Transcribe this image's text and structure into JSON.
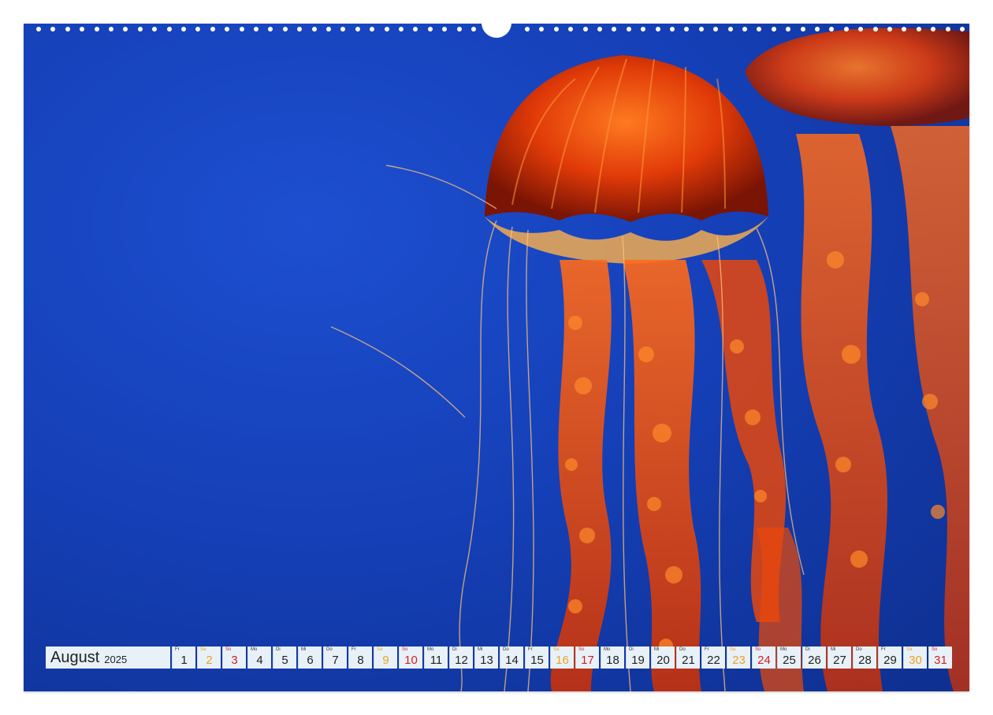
{
  "calendar": {
    "month": "August",
    "year": "2025",
    "days": [
      {
        "weekday": "Fr",
        "day": "1",
        "type": "weekday"
      },
      {
        "weekday": "Sa",
        "day": "2",
        "type": "sat"
      },
      {
        "weekday": "So",
        "day": "3",
        "type": "sun"
      },
      {
        "weekday": "Mo",
        "day": "4",
        "type": "weekday"
      },
      {
        "weekday": "Di",
        "day": "5",
        "type": "weekday"
      },
      {
        "weekday": "Mi",
        "day": "6",
        "type": "weekday"
      },
      {
        "weekday": "Do",
        "day": "7",
        "type": "weekday"
      },
      {
        "weekday": "Fr",
        "day": "8",
        "type": "weekday"
      },
      {
        "weekday": "Sa",
        "day": "9",
        "type": "sat"
      },
      {
        "weekday": "So",
        "day": "10",
        "type": "sun"
      },
      {
        "weekday": "Mo",
        "day": "11",
        "type": "weekday"
      },
      {
        "weekday": "Di",
        "day": "12",
        "type": "weekday"
      },
      {
        "weekday": "Mi",
        "day": "13",
        "type": "weekday"
      },
      {
        "weekday": "Do",
        "day": "14",
        "type": "weekday"
      },
      {
        "weekday": "Fr",
        "day": "15",
        "type": "weekday"
      },
      {
        "weekday": "Sa",
        "day": "16",
        "type": "sat"
      },
      {
        "weekday": "So",
        "day": "17",
        "type": "sun"
      },
      {
        "weekday": "Mo",
        "day": "18",
        "type": "weekday"
      },
      {
        "weekday": "Di",
        "day": "19",
        "type": "weekday"
      },
      {
        "weekday": "Mi",
        "day": "20",
        "type": "weekday"
      },
      {
        "weekday": "Do",
        "day": "21",
        "type": "weekday"
      },
      {
        "weekday": "Fr",
        "day": "22",
        "type": "weekday"
      },
      {
        "weekday": "Sa",
        "day": "23",
        "type": "sat"
      },
      {
        "weekday": "So",
        "day": "24",
        "type": "sun"
      },
      {
        "weekday": "Mo",
        "day": "25",
        "type": "weekday"
      },
      {
        "weekday": "Di",
        "day": "26",
        "type": "weekday"
      },
      {
        "weekday": "Mi",
        "day": "27",
        "type": "weekday"
      },
      {
        "weekday": "Do",
        "day": "28",
        "type": "weekday"
      },
      {
        "weekday": "Fr",
        "day": "29",
        "type": "weekday"
      },
      {
        "weekday": "Sa",
        "day": "30",
        "type": "sat"
      },
      {
        "weekday": "So",
        "day": "31",
        "type": "sun"
      }
    ]
  },
  "photo": {
    "subject": "jellyfish-photo",
    "background_color": "#1540b8",
    "accent_color": "#ff5a10"
  }
}
